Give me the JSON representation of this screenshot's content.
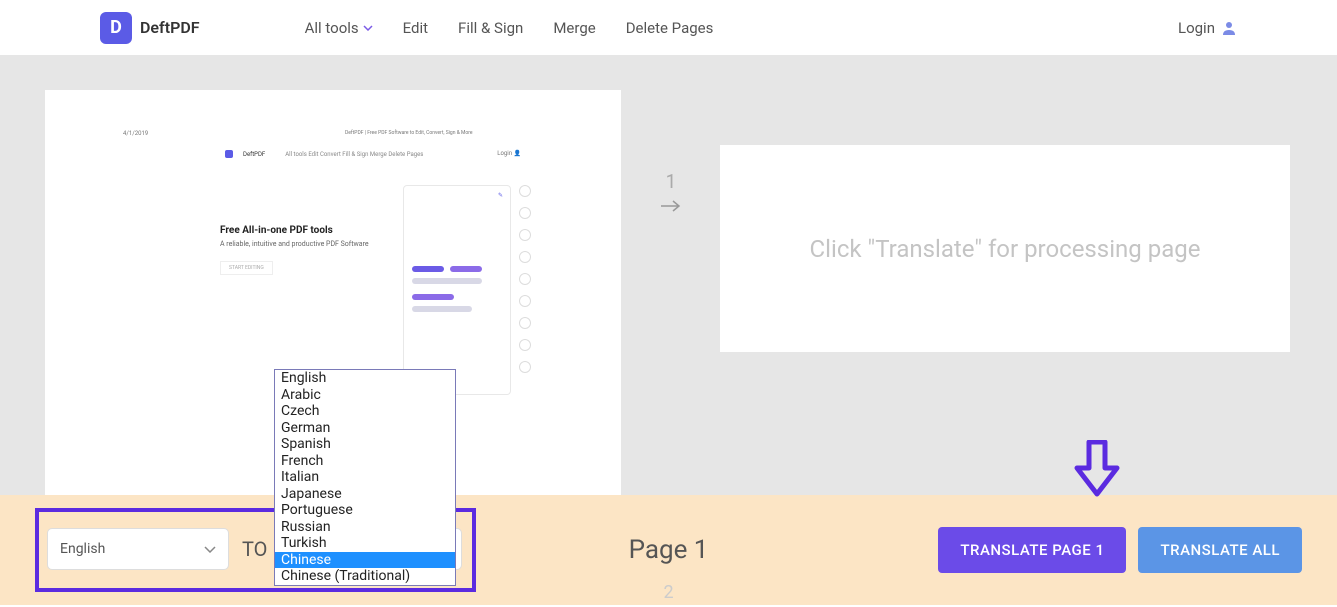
{
  "header": {
    "logo_letter": "D",
    "brand": "DeftPDF",
    "nav": {
      "all_tools": "All tools",
      "edit": "Edit",
      "fill_sign": "Fill & Sign",
      "merge": "Merge",
      "delete_pages": "Delete Pages"
    },
    "login": "Login"
  },
  "preview": {
    "date": "4/1/2019",
    "header_text": "DeftPDF | Free PDF Software to Edit, Convert, Sign & More",
    "brand": "DeftPDF",
    "nav_items": "All tools   Edit   Convert      Fill & Sign   Merge   Delete Pages",
    "login": "Login",
    "hero_title": "Free All-in-one PDF tools",
    "hero_sub": "A reliable, intuitive and productive PDF Software",
    "hero_btn": "START EDITING"
  },
  "pagination": {
    "step1": "1",
    "step2": "2"
  },
  "result": {
    "placeholder": "Click \"Translate\" for processing page"
  },
  "dropdown": {
    "options": [
      "English",
      "Arabic",
      "Czech",
      "German",
      "Spanish",
      "French",
      "Italian",
      "Japanese",
      "Portuguese",
      "Russian",
      "Turkish",
      "Chinese",
      "Chinese (Traditional)"
    ],
    "selected_index": 11
  },
  "toolbar": {
    "source_lang": "English",
    "to_label": "TO",
    "target_lang": "Chinese",
    "page_label": "Page 1",
    "translate_page": "TRANSLATE PAGE 1",
    "translate_all": "TRANSLATE ALL"
  }
}
